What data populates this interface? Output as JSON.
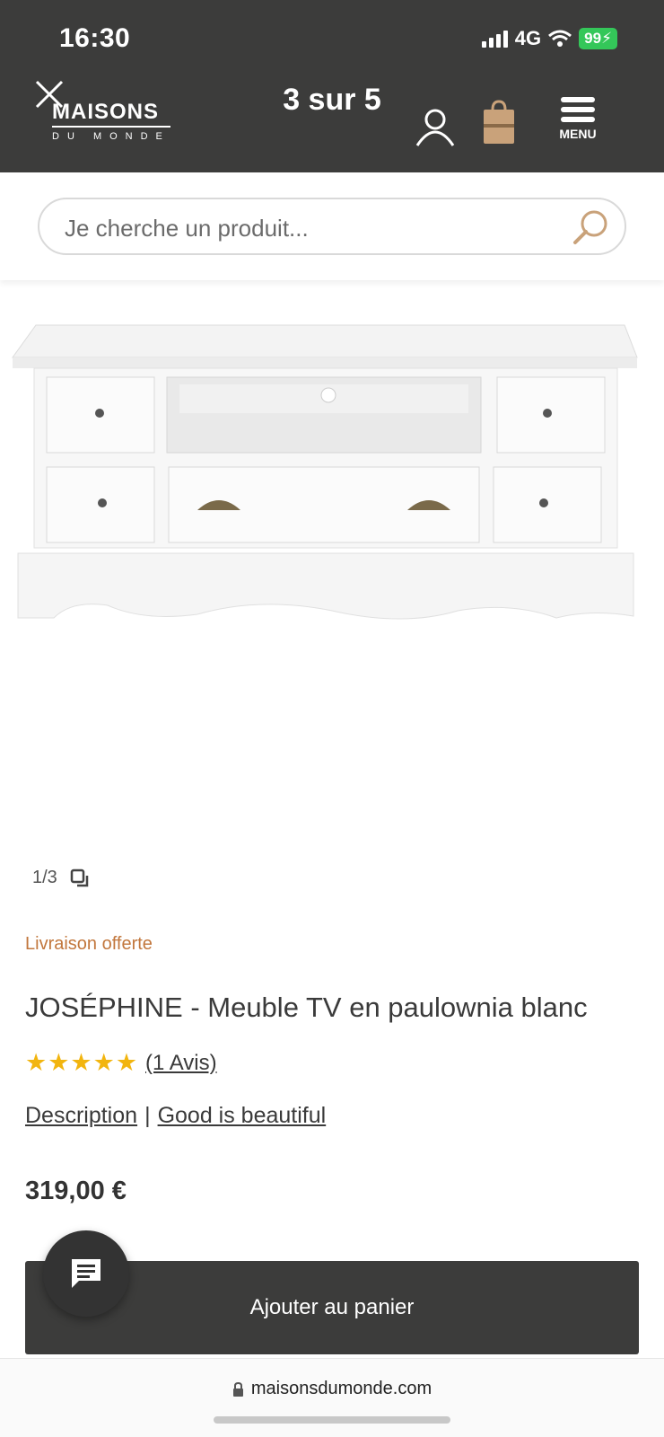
{
  "status_bar": {
    "time": "16:30",
    "network": "4G",
    "battery": "99"
  },
  "header": {
    "logo_main": "MAISONS",
    "logo_sub": "DU MONDE",
    "page_counter": "3 sur 5",
    "menu_label": "MENU"
  },
  "search": {
    "placeholder": "Je cherche un produit..."
  },
  "gallery": {
    "counter": "1/3"
  },
  "product": {
    "delivery": "Livraison offerte",
    "title": "JOSÉPHINE - Meuble TV en paulownia blanc",
    "stars": "★★★★★",
    "rating_value": 5,
    "reviews_link": "(1 Avis)",
    "description_link": "Description",
    "separator": "|",
    "good_link": "Good is beautiful",
    "price": "319,00 €"
  },
  "actions": {
    "add_to_cart": "Ajouter au panier"
  },
  "browser": {
    "url": "maisonsdumonde.com"
  },
  "colors": {
    "header_bg": "#3c3c3b",
    "accent_orange": "#c2773d",
    "star": "#f2b50f",
    "battery": "#34c759"
  },
  "icons": [
    "close-icon",
    "account-icon",
    "shopping-bag-icon",
    "menu-icon",
    "search-icon",
    "gallery-icon",
    "chat-icon",
    "lock-icon"
  ]
}
